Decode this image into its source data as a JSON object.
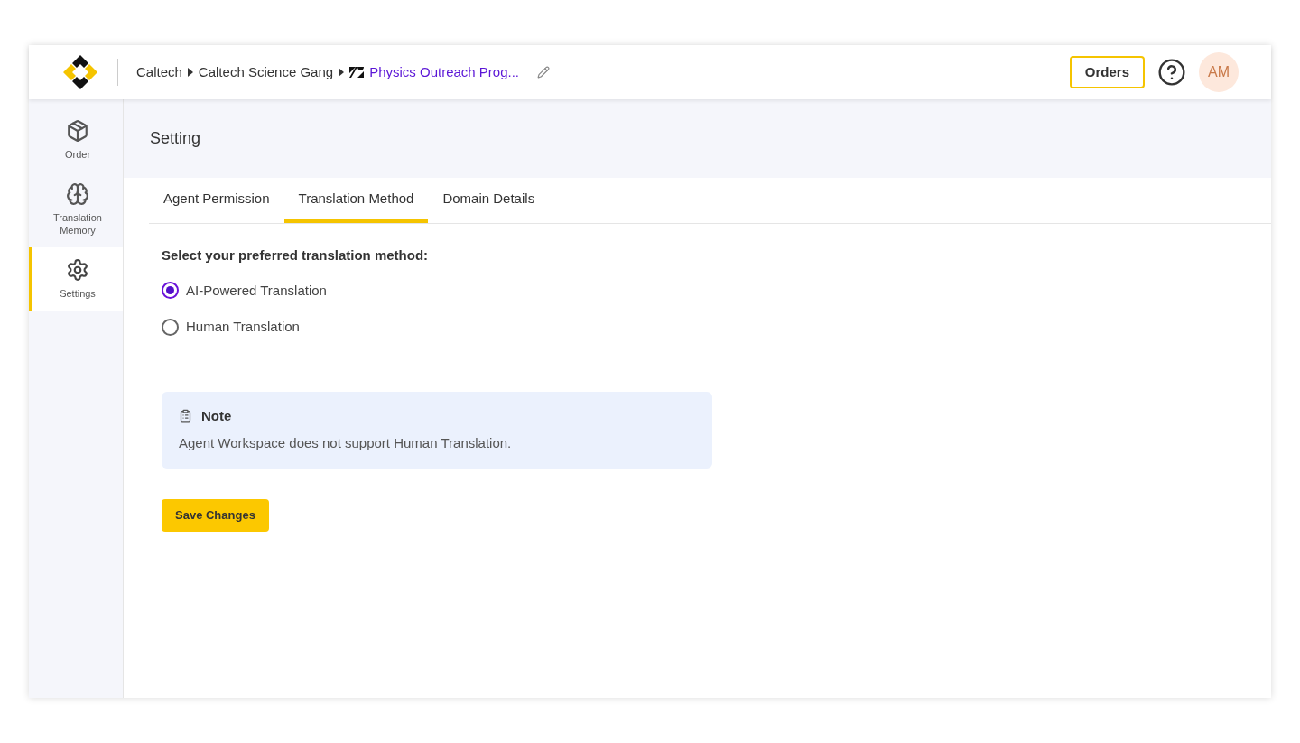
{
  "header": {
    "breadcrumb": [
      {
        "label": "Caltech",
        "kind": "plain"
      },
      {
        "label": "Caltech Science Gang",
        "kind": "plain"
      },
      {
        "label": "Physics Outreach Prog...",
        "kind": "link"
      }
    ],
    "orders_button": "Orders",
    "avatar": "AM"
  },
  "sidebar": {
    "items": [
      {
        "label": "Order",
        "selected": false
      },
      {
        "label": "Translation Memory",
        "selected": false
      },
      {
        "label": "Settings",
        "selected": true
      }
    ]
  },
  "page_title": "Setting",
  "tabs": [
    {
      "label": "Agent Permission",
      "selected": false
    },
    {
      "label": "Translation Method",
      "selected": true
    },
    {
      "label": "Domain Details",
      "selected": false
    }
  ],
  "prompt": "Select your preferred translation method:",
  "options": [
    {
      "label": "AI-Powered Translation",
      "selected": true
    },
    {
      "label": "Human Translation",
      "selected": false
    }
  ],
  "note": {
    "title": "Note",
    "text": "Agent Workspace does not support Human Translation."
  },
  "save_button": "Save Changes"
}
